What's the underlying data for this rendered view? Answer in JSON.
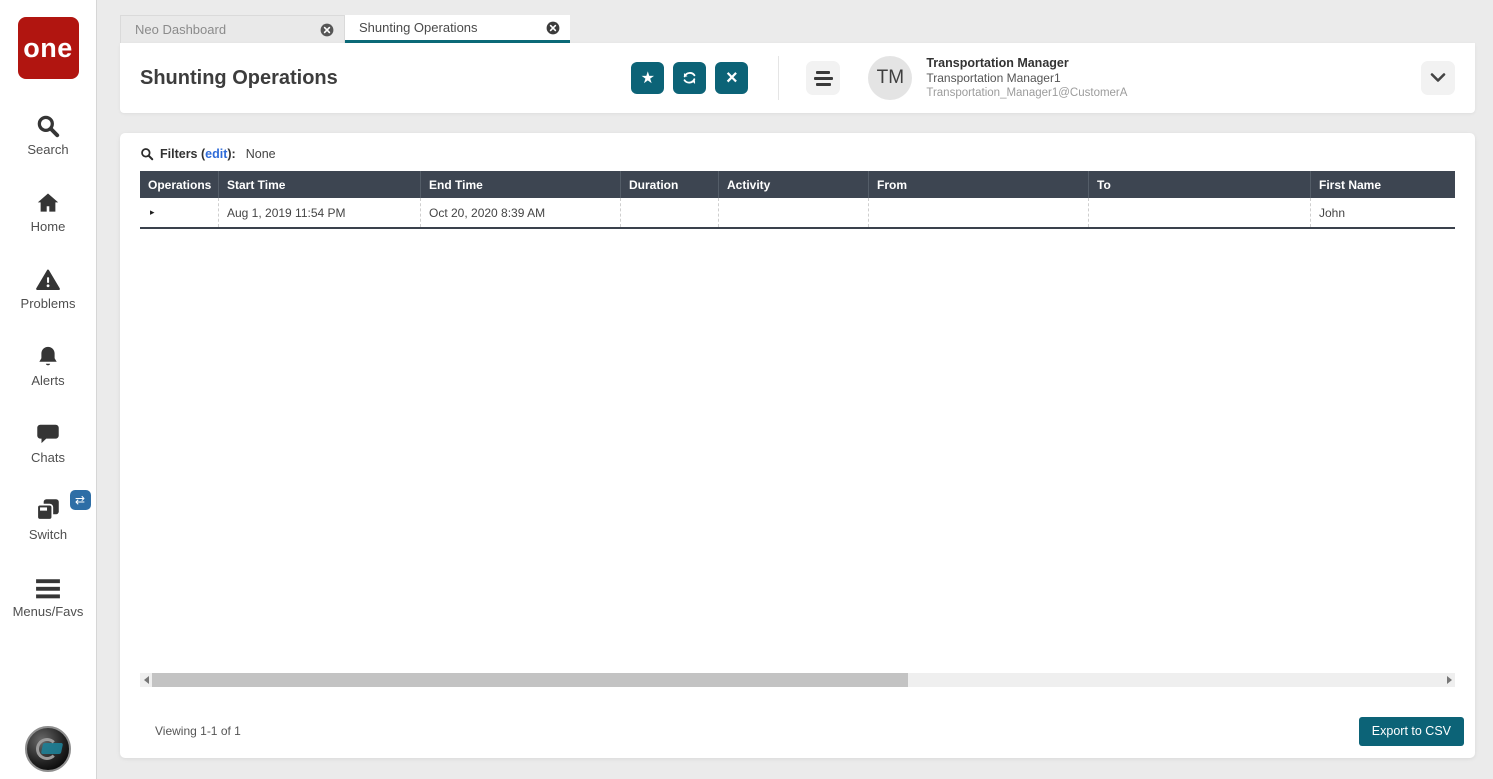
{
  "sidebar": {
    "logo_text": "one",
    "items": [
      {
        "label": "Search",
        "icon": "search-icon"
      },
      {
        "label": "Home",
        "icon": "home-icon"
      },
      {
        "label": "Problems",
        "icon": "problems-warning-icon"
      },
      {
        "label": "Alerts",
        "icon": "alerts-bell-icon"
      },
      {
        "label": "Chats",
        "icon": "chats-bubble-icon"
      },
      {
        "label": "Switch",
        "icon": "switch-cards-icon",
        "badge_glyph": "⇄"
      },
      {
        "label": "Menus/Favs",
        "icon": "menus-favs-icon"
      }
    ]
  },
  "tabs": [
    {
      "label": "Neo Dashboard",
      "active": false
    },
    {
      "label": "Shunting Operations",
      "active": true
    }
  ],
  "header": {
    "title": "Shunting Operations",
    "favorite_glyph": "★",
    "close_glyph": "×",
    "user": {
      "initials": "TM",
      "role": "Transportation Manager",
      "name": "Transportation Manager1",
      "account": "Transportation_Manager1@CustomerA"
    }
  },
  "filters": {
    "label": "Filters (",
    "edit_link": "edit",
    "label_suffix": "):",
    "value": "None"
  },
  "table": {
    "columns": [
      "Operations",
      "Start Time",
      "End Time",
      "Duration",
      "Activity",
      "From",
      "To",
      "First Name"
    ],
    "rows": [
      [
        "▸",
        "Aug 1, 2019 11:54 PM",
        "Oct 20, 2020 8:39 AM",
        "",
        "",
        "",
        "",
        "John"
      ]
    ]
  },
  "footer": {
    "viewing": "Viewing 1-1 of 1",
    "export_label": "Export to CSV"
  },
  "colors": {
    "accent_teal": "#0c6377",
    "table_header_slate": "#3d4551",
    "brand_red": "#b11510",
    "link_blue": "#2f6bd8",
    "switch_badge_blue": "#2e6ea6"
  }
}
